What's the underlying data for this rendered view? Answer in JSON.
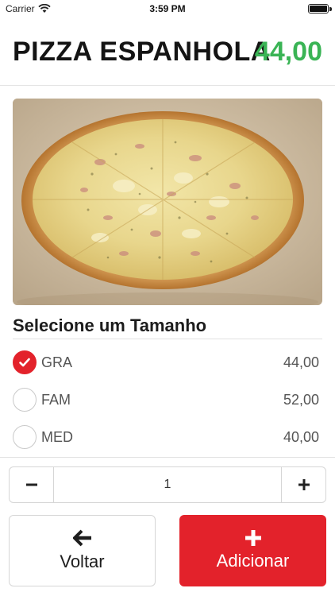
{
  "status_bar": {
    "carrier": "Carrier",
    "time": "3:59 PM",
    "icons": [
      "wifi-icon",
      "battery-icon"
    ]
  },
  "header": {
    "product_name": "PIZZA ESPANHOLA",
    "price": "44,00",
    "price_color": "#3ab455"
  },
  "size_section": {
    "title": "Selecione um Tamanho",
    "options": [
      {
        "label": "GRA",
        "price": "44,00",
        "selected": true
      },
      {
        "label": "FAM",
        "price": "52,00",
        "selected": false
      },
      {
        "label": "MED",
        "price": "40,00",
        "selected": false
      }
    ]
  },
  "quantity": {
    "decrement_icon": "minus-icon",
    "value": "1",
    "increment_icon": "plus-icon"
  },
  "actions": {
    "back_label": "Voltar",
    "back_icon": "arrow-left-icon",
    "add_label": "Adicionar",
    "add_icon": "plus-icon",
    "accent_color": "#e3222b"
  }
}
